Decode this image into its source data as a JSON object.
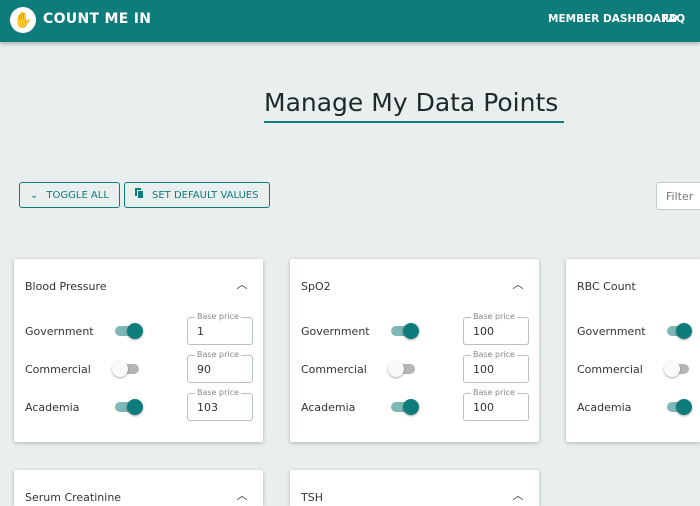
{
  "header": {
    "brand": "COUNT ME IN",
    "logo_icon": "raised-hand-icon",
    "nav": [
      "MEMBER DASHBOARD",
      "FAQ"
    ]
  },
  "page": {
    "title": "Manage My Data Points"
  },
  "toolbar": {
    "toggle_all": "TOGGLE ALL",
    "set_defaults": "SET DEFAULT VALUES",
    "filter_placeholder": "Filter"
  },
  "cards": [
    {
      "title": "Blood Pressure",
      "rows": [
        {
          "label": "Government",
          "enabled": true,
          "price_label": "Base price",
          "price": "1"
        },
        {
          "label": "Commercial",
          "enabled": false,
          "price_label": "Base price",
          "price": "90"
        },
        {
          "label": "Academia",
          "enabled": true,
          "price_label": "Base price",
          "price": "103"
        }
      ]
    },
    {
      "title": "SpO2",
      "rows": [
        {
          "label": "Government",
          "enabled": true,
          "price_label": "Base price",
          "price": "100"
        },
        {
          "label": "Commercial",
          "enabled": false,
          "price_label": "Base price",
          "price": "100"
        },
        {
          "label": "Academia",
          "enabled": true,
          "price_label": "Base price",
          "price": "100"
        }
      ]
    },
    {
      "title": "RBC Count",
      "rows": [
        {
          "label": "Government",
          "enabled": true
        },
        {
          "label": "Commercial",
          "enabled": false
        },
        {
          "label": "Academia",
          "enabled": true
        }
      ]
    },
    {
      "title": "Serum Creatinine",
      "rows": []
    },
    {
      "title": "TSH",
      "rows": []
    }
  ],
  "colors": {
    "primary": "#0e7c7b",
    "background": "#e9eeee"
  }
}
